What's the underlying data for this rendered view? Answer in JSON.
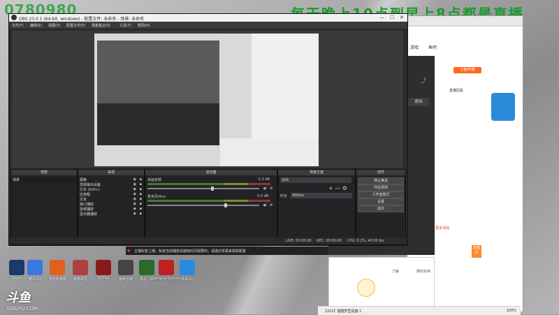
{
  "overlay": {
    "phone_partial": "0780980",
    "schedule_partial": "每天晚上10点到早上8点都是直播",
    "douyu_logo": "斗鱼",
    "douyu_url": "DOUYU.COM"
  },
  "obs": {
    "title": "OBS 23.0.1 (64-bit, windows) - 配置文件: 未命名 - 场景: 未命名",
    "menu": [
      "文件(F)",
      "编辑(E)",
      "视图(V)",
      "配置文件(P)",
      "场景集合(S)",
      "工具(T)",
      "帮助(H)"
    ],
    "docks": {
      "scenes": {
        "title": "场景",
        "items": [
          "场景"
        ]
      },
      "sources": {
        "title": "来源",
        "items": [
          "图像",
          "音频输出设备",
          "文本 (GDI+)",
          "应用程",
          "文本",
          "窗口捕获",
          "音频捕获",
          "显示器捕获"
        ]
      },
      "mixer": {
        "title": "混音器",
        "tracks": [
          {
            "name": "桌面音频",
            "db": "-1.2 dB",
            "level": 0.58
          },
          {
            "name": "麦克风/Aux",
            "db": "0.0 dB",
            "level": 0.7
          }
        ]
      },
      "transitions": {
        "title": "场景过渡",
        "type_value": "淡出",
        "duration_label": "时长",
        "duration_value": "300ms"
      },
      "controls": {
        "title": "控件",
        "buttons": [
          "停止推流",
          "开始录制",
          "工作室模式",
          "设置",
          "退出"
        ]
      }
    },
    "status": {
      "live": "LIVE: 00:00:00",
      "rec": "REC: 00:00:00",
      "cpu": "CPU: 0.2%, 40.00 fps"
    }
  },
  "notice": "主播标签上播，知道当前播放设施缺时间需要的，请通过举报来获取配置",
  "browser": {
    "tabs_partial": [
      "游戏",
      "鱼吧"
    ],
    "right_texts": [
      "斗鱼PK赛",
      "直播回看",
      "更多活动",
      "充值并"
    ],
    "stream_panel": {
      "exit_button": "退出"
    },
    "chat": {
      "label_left": "了解",
      "label_right": "我的东西"
    }
  },
  "bottombar": {
    "tab": "【201】猫猫梦里是猫 1",
    "zoom": "100%"
  },
  "desktop_icons": [
    {
      "label": "Steam",
      "color": "#1a3a6a"
    },
    {
      "label": "腾讯QQ",
      "color": "#3a7ae0"
    },
    {
      "label": "游戏加速器",
      "color": "#e06020"
    },
    {
      "label": "英雄联盟",
      "color": "#b04040"
    },
    {
      "label": "DOTA2",
      "color": "#8a1a1a"
    },
    {
      "label": "使命召唤",
      "color": "#444"
    },
    {
      "label": "极品飞车",
      "color": "#2a6a2a"
    },
    {
      "label": "Vampire Survivors",
      "color": "#c02020"
    },
    {
      "label": "网易UU",
      "color": "#2a8ae0"
    }
  ],
  "colors": {
    "obs_bg": "#2b2b2d",
    "accent_green": "#1a9a2a",
    "douyu_orange": "#ff6a1a"
  }
}
